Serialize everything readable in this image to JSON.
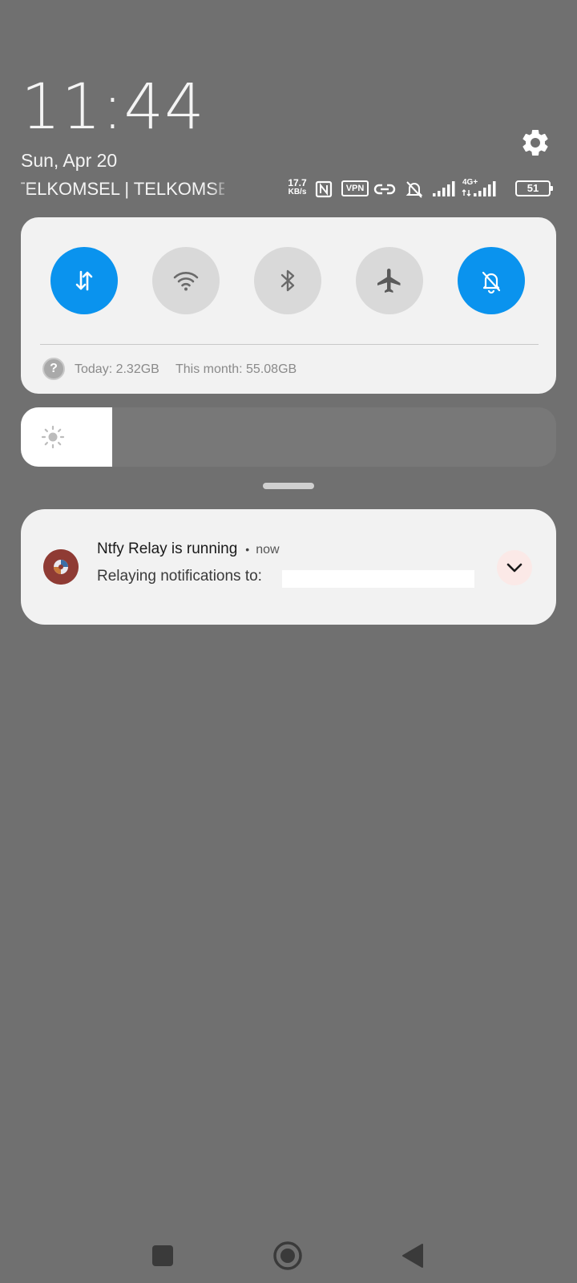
{
  "status": {
    "time": "11:44",
    "date": "Sun, Apr 20",
    "carriers": "TELKOMSEL | TELKOMSEL",
    "net_speed_value": "17.7",
    "net_speed_unit": "KB/s",
    "vpn_label": "VPN",
    "network_type": "4G+",
    "battery_level": "51"
  },
  "quick_settings": {
    "tiles": [
      {
        "name": "mobile-data",
        "state": "on",
        "icon": "data-transfer-icon"
      },
      {
        "name": "wifi",
        "state": "off",
        "icon": "wifi-icon"
      },
      {
        "name": "bluetooth",
        "state": "off",
        "icon": "bluetooth-icon"
      },
      {
        "name": "airplane-mode",
        "state": "off",
        "icon": "airplane-icon"
      },
      {
        "name": "silent-mode",
        "state": "on",
        "icon": "bell-off-icon"
      }
    ],
    "data_help_icon": "?",
    "today_usage": "Today: 2.32GB",
    "month_usage": "This month: 55.08GB",
    "accent_color": "#0a93ee"
  },
  "brightness": {
    "level_fraction": 0.17,
    "icon": "sun-icon"
  },
  "notification": {
    "title": "Ntfy Relay is running",
    "separator": "•",
    "time": "now",
    "body": "Relaying notifications to:",
    "app_icon": "ntfy-relay-app-icon",
    "expand_icon": "chevron-down-icon"
  },
  "navigation": {
    "recents_icon": "square-icon",
    "home_icon": "circle-icon",
    "back_icon": "triangle-back-icon"
  }
}
